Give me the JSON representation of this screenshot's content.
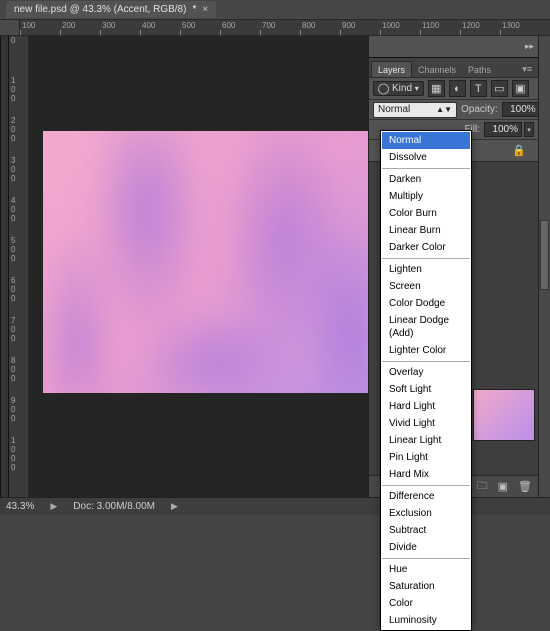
{
  "document": {
    "title": "new file.psd @ 43.3% (Accent, RGB/8)",
    "dirty_mark": "*"
  },
  "ruler": {
    "top_ticks": [
      "100",
      "200",
      "300",
      "400",
      "500",
      "600",
      "700",
      "800",
      "900",
      "1000",
      "1100",
      "1200",
      "1300"
    ],
    "left_ticks": [
      "0",
      "100",
      "200",
      "300",
      "400",
      "500",
      "600",
      "700",
      "800",
      "900",
      "1000"
    ]
  },
  "panels": {
    "tabs": {
      "layers": "Layers",
      "channels": "Channels",
      "paths": "Paths"
    },
    "filter_kind": "Kind",
    "blend_label": "Normal",
    "opacity_label": "Opacity:",
    "opacity_value": "100%",
    "fill_label": "Fill:",
    "fill_value": "100%"
  },
  "blend_modes": {
    "group1": [
      "Normal",
      "Dissolve"
    ],
    "group2": [
      "Darken",
      "Multiply",
      "Color Burn",
      "Linear Burn",
      "Darker Color"
    ],
    "group3": [
      "Lighten",
      "Screen",
      "Color Dodge",
      "Linear Dodge (Add)",
      "Lighter Color"
    ],
    "group4": [
      "Overlay",
      "Soft Light",
      "Hard Light",
      "Vivid Light",
      "Linear Light",
      "Pin Light",
      "Hard Mix"
    ],
    "group5": [
      "Difference",
      "Exclusion",
      "Subtract",
      "Divide"
    ],
    "group6": [
      "Hue",
      "Saturation",
      "Color",
      "Luminosity"
    ],
    "selected": "Normal"
  },
  "status": {
    "zoom": "43.3%",
    "doc": "Doc: 3.00M/8.00M"
  }
}
